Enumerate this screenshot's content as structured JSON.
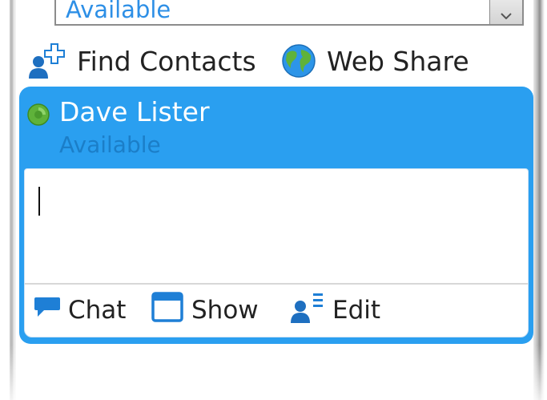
{
  "status_select": {
    "value": "Available",
    "arrow_icon": "dropdown-arrow-icon"
  },
  "toolbar": {
    "find_contacts": {
      "label": "Find Contacts",
      "icon": "add-contact-icon"
    },
    "web_share": {
      "label": "Web Share",
      "icon": "globe-icon"
    }
  },
  "contact": {
    "name": "Dave Lister",
    "status": "Available",
    "presence_icon": "presence-online-icon",
    "message_value": "",
    "actions": {
      "chat": {
        "label": "Chat",
        "icon": "chat-bubble-icon"
      },
      "show": {
        "label": "Show",
        "icon": "window-icon"
      },
      "edit": {
        "label": "Edit",
        "icon": "edit-contact-icon"
      }
    }
  },
  "colors": {
    "accent": "#2a9ff0",
    "status_text": "#1b7ec8",
    "presence_green": "#6cc24a",
    "icon_blue": "#1e7fd6"
  }
}
